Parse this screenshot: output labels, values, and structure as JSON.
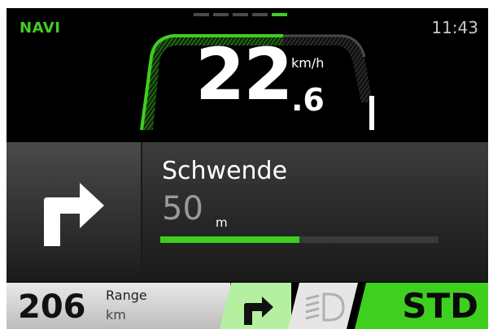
{
  "header": {
    "mode": "NAVI",
    "time": "11:43"
  },
  "pager": {
    "count": 5,
    "active_index": 4
  },
  "speed": {
    "integer": "22",
    "decimal": ".6",
    "unit": "km/h"
  },
  "navigation": {
    "maneuver_icon": "turn-right-icon",
    "street": "Schwende",
    "distance": "50",
    "distance_unit": "m",
    "progress_fraction": 0.5
  },
  "range": {
    "value": "206",
    "label": "Range",
    "unit": "km"
  },
  "bottom_buttons": {
    "turn_icon": "turn-right-icon",
    "light_icon": "headlight-icon",
    "assist_mode": "STD"
  },
  "colors": {
    "accent": "#3fcf1f",
    "accent_light": "#b4f0a0",
    "background": "#000000"
  }
}
